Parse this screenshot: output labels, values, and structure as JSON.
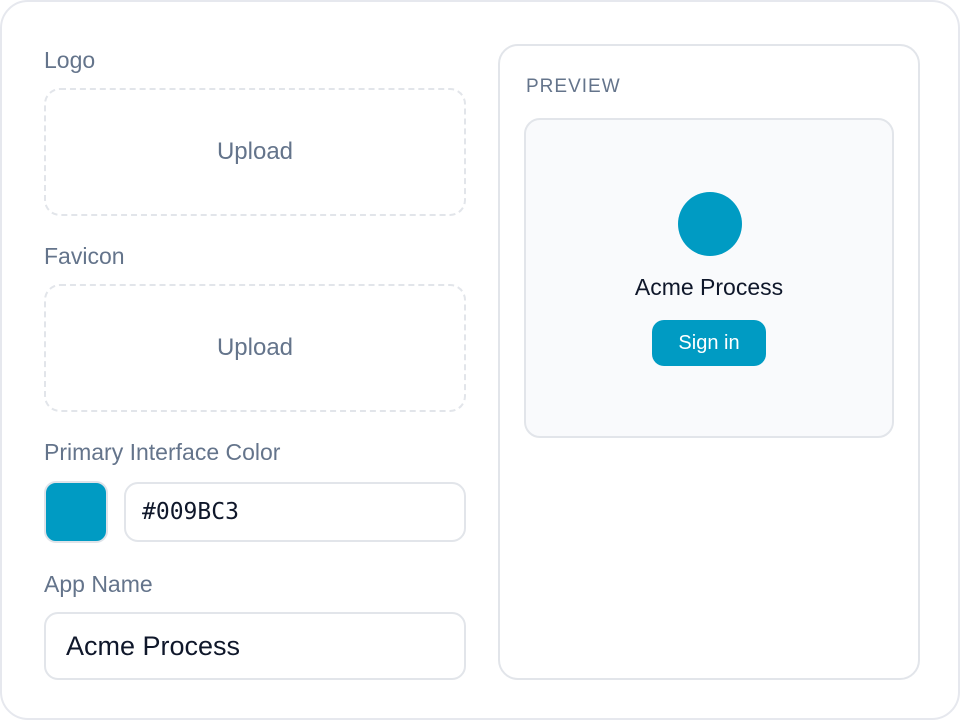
{
  "form": {
    "logo": {
      "label": "Logo",
      "upload_text": "Upload"
    },
    "favicon": {
      "label": "Favicon",
      "upload_text": "Upload"
    },
    "primary_color": {
      "label": "Primary Interface Color",
      "value": "#009BC3"
    },
    "app_name": {
      "label": "App Name",
      "value": "Acme Process"
    }
  },
  "preview": {
    "title": "PREVIEW",
    "app_name": "Acme Process",
    "sign_in_label": "Sign in"
  },
  "colors": {
    "primary": "#009BC3"
  }
}
